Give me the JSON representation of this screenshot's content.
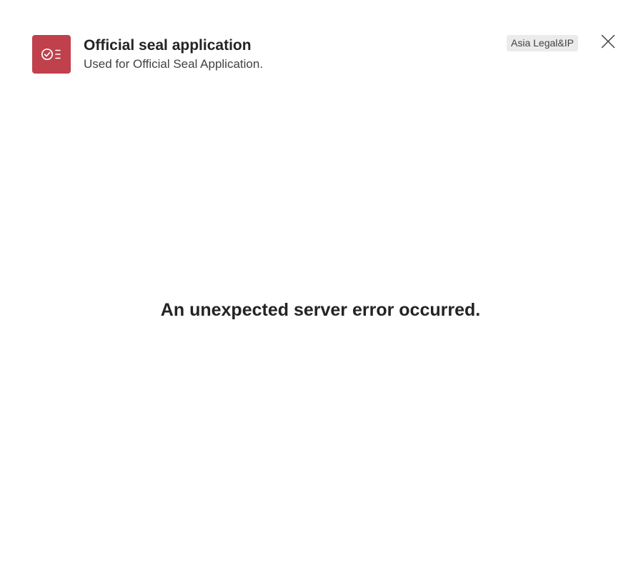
{
  "header": {
    "app_icon": "checklist-icon",
    "app_icon_color": "#c0404c",
    "title": "Official seal application",
    "subtitle": "Used for Official Seal Application.",
    "tag": "Asia Legal&IP",
    "close_icon": "close-icon"
  },
  "main": {
    "error_message": "An unexpected server error occurred."
  }
}
